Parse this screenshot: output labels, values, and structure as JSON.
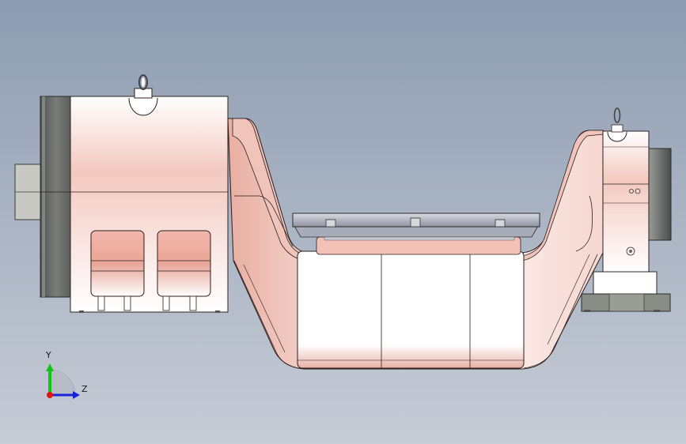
{
  "viewport": {
    "background_top": "#8d9cb1",
    "background_bottom": "#c7ccd6"
  },
  "model": {
    "body_color": "#e9b7ac",
    "body_highlight": "#ffffff",
    "edge_color": "#2b1f1d",
    "motor_cap_color": "#6a6d6a",
    "motor_cap_light": "#b9bbb6",
    "table_color": "#b9bcc6",
    "base_color": "#8a8c86"
  },
  "triad": {
    "y_label": "Y",
    "z_label": "Z",
    "y_color": "#14c414",
    "z_color": "#1a22d8",
    "x_color": "#e01414"
  }
}
